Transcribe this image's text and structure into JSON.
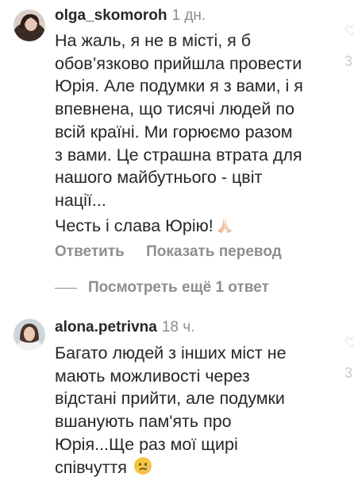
{
  "comments": [
    {
      "username": "olga_skomoroh",
      "time": "1 дн.",
      "lines": [
        "На жаль, я не в місті, я б",
        "обов’язково прийшла провести",
        "Юрія. Але подумки я з вами, і я",
        "впевнена, що тисячі людей по",
        "всій країні. Ми горюємо разом",
        "з вами. Це страшна втрата для",
        "нашого майбутнього - цвіт",
        "нації..."
      ],
      "last_line": "Честь і слава Юрію!",
      "last_emoji": "folded-hands-emoji",
      "reply_label": "Ответить",
      "translate_label": "Показать перевод",
      "side_glyph": "3"
    },
    {
      "username": "alona.petrivna",
      "time": "18 ч.",
      "lines": [
        "Багато людей з інших міст не",
        "мають можливості через",
        "відстані прийти, але подумки",
        "вшанують пам'ять про",
        "Юрія...Ще раз мої щирі"
      ],
      "last_line": "співчуття",
      "last_emoji": "crying-face-emoji",
      "side_glyph": "3"
    }
  ],
  "view_more_replies": "Посмотреть ещё 1 ответ"
}
